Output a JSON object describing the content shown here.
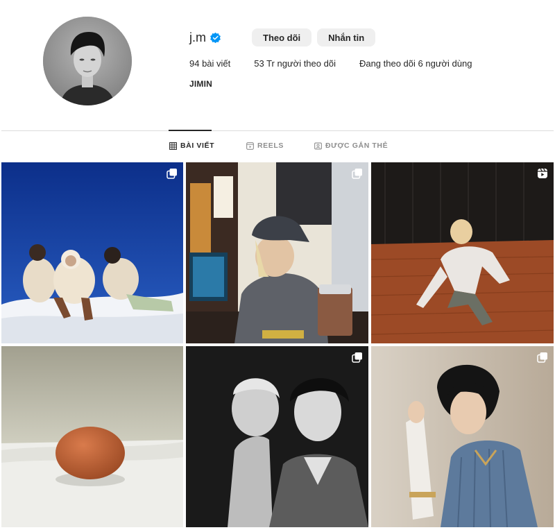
{
  "profile": {
    "username": "j.m",
    "verified": true,
    "follow_label": "Theo dõi",
    "message_label": "Nhắn tin",
    "stats": {
      "posts": "94 bài viết",
      "followers": "53 Tr người theo dõi",
      "following": "Đang theo dõi 6 người dùng"
    },
    "full_name": "JIMIN"
  },
  "tabs": [
    {
      "label": "BÀI VIẾT",
      "icon": "grid-icon",
      "active": true
    },
    {
      "label": "REELS",
      "icon": "reels-icon",
      "active": false
    },
    {
      "label": "ĐƯỢC GẮN THẺ",
      "icon": "tagged-icon",
      "active": false
    }
  ],
  "posts": [
    {
      "description_icon": "carousel-icon",
      "badge": "carousel"
    },
    {
      "description_icon": "carousel-icon",
      "badge": "carousel"
    },
    {
      "description_icon": "reels-icon",
      "badge": "reel"
    },
    {
      "description_icon": "none",
      "badge": "none"
    },
    {
      "description_icon": "carousel-icon",
      "badge": "carousel"
    },
    {
      "description_icon": "carousel-icon",
      "badge": "carousel"
    }
  ],
  "colors": {
    "verified_blue": "#0095f6",
    "button_bg": "#efefef",
    "divider": "#dbdbdb",
    "text": "#262626",
    "muted_text": "#8e8e8e"
  }
}
